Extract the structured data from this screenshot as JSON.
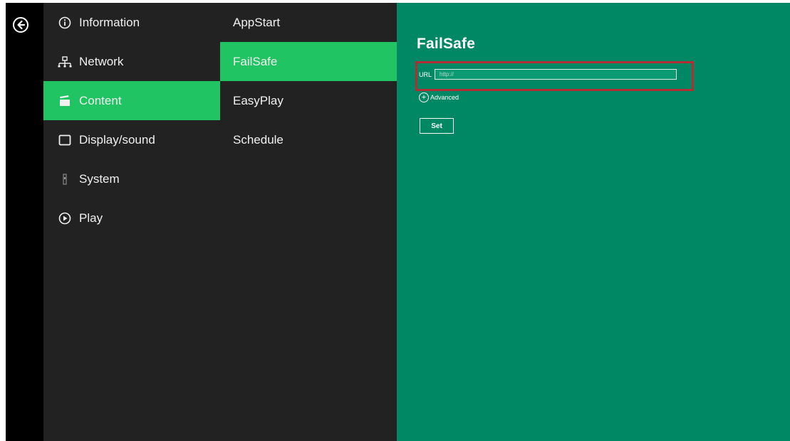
{
  "nav": {
    "back_icon": "arrow-left-circle-icon",
    "primary": [
      {
        "label": "Information",
        "icon": "info-icon",
        "active": false
      },
      {
        "label": "Network",
        "icon": "network-icon",
        "active": false
      },
      {
        "label": "Content",
        "icon": "clapperboard-icon",
        "active": true
      },
      {
        "label": "Display/sound",
        "icon": "display-icon",
        "active": false
      },
      {
        "label": "System",
        "icon": "system-icon",
        "active": false
      },
      {
        "label": "Play",
        "icon": "play-icon",
        "active": false
      }
    ],
    "secondary": [
      {
        "label": "AppStart",
        "active": false
      },
      {
        "label": "FailSafe",
        "active": true
      },
      {
        "label": "EasyPlay",
        "active": false
      },
      {
        "label": "Schedule",
        "active": false
      }
    ]
  },
  "panel": {
    "title": "FailSafe",
    "url_label": "URL",
    "url_value": "http://",
    "advanced_label": "Advanced",
    "set_label": "Set"
  },
  "colors": {
    "active_item": "#21c463",
    "panel_background": "#008763",
    "menu_background": "#222222",
    "highlight_border": "#b22e34"
  }
}
